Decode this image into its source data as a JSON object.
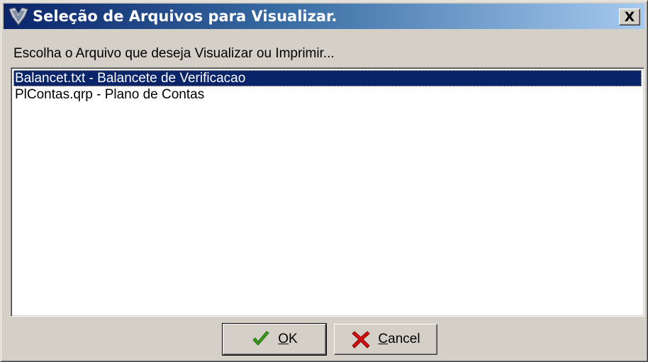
{
  "window": {
    "title": "Seleção de Arquivos para Visualizar.",
    "close_label": "X",
    "app_icon": "shield-bird-icon"
  },
  "prompt": "Escolha o Arquivo que deseja Visualizar ou Imprimir...",
  "files": [
    {
      "label": "Balancet.txt - Balancete de Verificacao",
      "selected": true
    },
    {
      "label": "PlContas.qrp - Plano de Contas",
      "selected": false
    }
  ],
  "buttons": {
    "ok": {
      "accel": "O",
      "rest": "K",
      "icon": "checkmark-icon"
    },
    "cancel": {
      "accel": "C",
      "rest": "ancel",
      "icon": "x-mark-icon"
    }
  },
  "colors": {
    "selection": "#0a246a",
    "ok_icon": "#3a9a1a",
    "cancel_icon": "#d01010"
  }
}
